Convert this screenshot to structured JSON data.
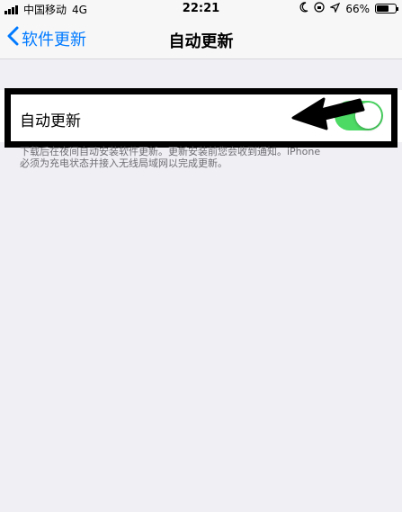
{
  "status_bar": {
    "carrier": "中国移动",
    "network": "4G",
    "time": "22:21",
    "battery": "66%",
    "icons": [
      "signal-icon",
      "moon-icon",
      "rotation-lock-icon",
      "location-arrow-icon",
      "battery-icon"
    ]
  },
  "nav": {
    "back_label": "软件更新",
    "back_icon": "chevron-left-icon",
    "title": "自动更新"
  },
  "setting": {
    "label": "自动更新",
    "toggle_on": true
  },
  "footer": {
    "note": "下载后在夜间自动安装软件更新。更新安装前您会收到通知。iPhone\n必须为充电状态并接入无线局域网以完成更新。"
  },
  "colors": {
    "accent": "#007aff",
    "toggle_on": "#4cd964",
    "background": "#efeff4",
    "annotation": "#000000"
  }
}
